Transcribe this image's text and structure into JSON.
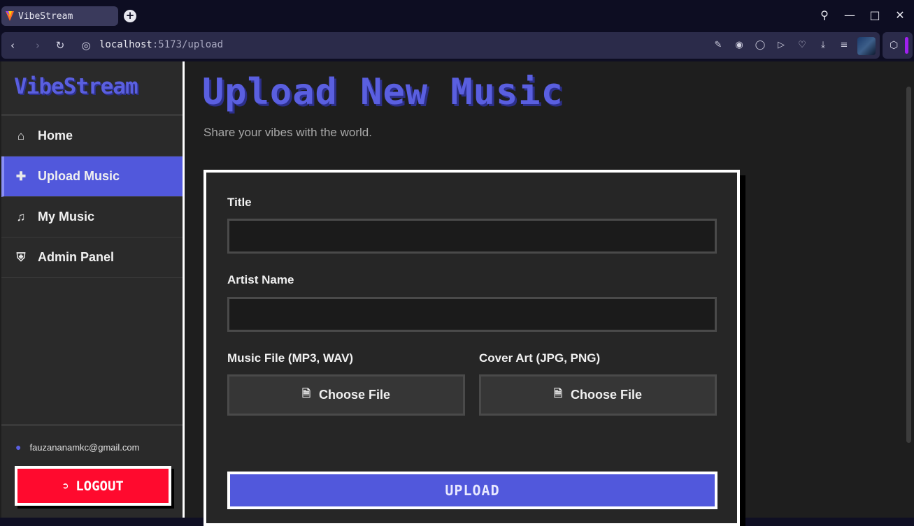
{
  "browser": {
    "tab_title": "VibeStream",
    "url_host": "localhost",
    "url_rest": ":5173/upload"
  },
  "sidebar": {
    "brand": "VibeStream",
    "items": [
      {
        "label": "Home",
        "icon": "home-icon"
      },
      {
        "label": "Upload Music",
        "icon": "plus-icon",
        "active": true
      },
      {
        "label": "My Music",
        "icon": "music-note-icon"
      },
      {
        "label": "Admin Panel",
        "icon": "shield-icon"
      }
    ],
    "user_email": "fauzananamkc@gmail.com",
    "logout_label": "LOGOUT"
  },
  "main": {
    "title": "Upload New Music",
    "subtitle": "Share your vibes with the world.",
    "form": {
      "title_label": "Title",
      "title_value": "",
      "artist_label": "Artist Name",
      "artist_value": "",
      "music_label": "Music File (MP3, WAV)",
      "cover_label": "Cover Art (JPG, PNG)",
      "choose_file": "Choose File",
      "upload_label": "UPLOAD"
    }
  },
  "colors": {
    "accent": "#5158dc",
    "logout": "#ff0a2e",
    "background": "#1e1e1e"
  }
}
